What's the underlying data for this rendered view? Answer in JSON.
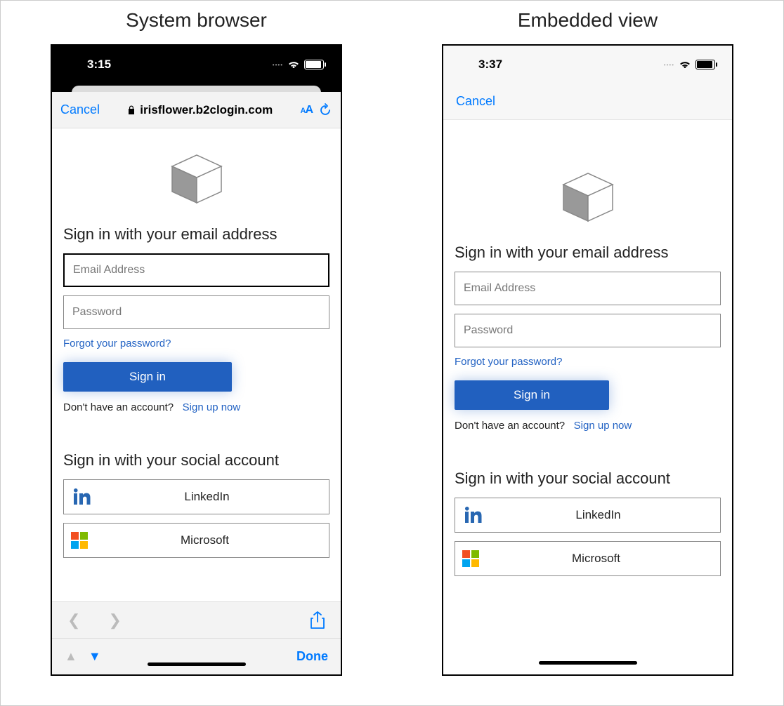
{
  "titles": {
    "left": "System browser",
    "right": "Embedded view"
  },
  "status": {
    "time_left": "3:15",
    "time_right": "3:37"
  },
  "safari": {
    "cancel": "Cancel",
    "url_host": "irisflower.b2clogin.com",
    "aa_small": "A",
    "aa_big": "A",
    "done": "Done"
  },
  "embed": {
    "cancel": "Cancel"
  },
  "form": {
    "heading": "Sign in with your email address",
    "email_placeholder": "Email Address",
    "password_placeholder": "Password",
    "forgot": "Forgot your password?",
    "signin": "Sign in",
    "no_account": "Don't have an account?",
    "signup": "Sign up now"
  },
  "social": {
    "heading": "Sign in with your social account",
    "linkedin": "LinkedIn",
    "microsoft": "Microsoft"
  }
}
